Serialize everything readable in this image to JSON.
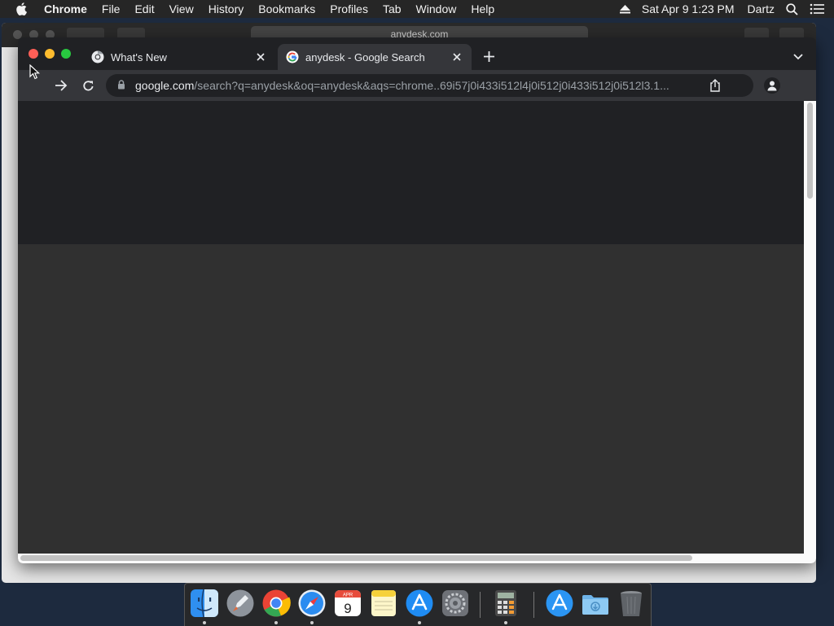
{
  "menubar": {
    "app_name": "Chrome",
    "items": [
      "File",
      "Edit",
      "View",
      "History",
      "Bookmarks",
      "Profiles",
      "Tab",
      "Window",
      "Help"
    ],
    "clock": "Sat Apr 9  1:23 PM",
    "user": "Dartz",
    "icons": [
      "apple-icon",
      "eject-icon",
      "spotlight-icon",
      "control-center-icon"
    ]
  },
  "background_window": {
    "url": "anydesk.com"
  },
  "chrome": {
    "tabs": [
      {
        "title": "What's New",
        "favicon": "chrome-icon",
        "active": false
      },
      {
        "title": "anydesk - Google Search",
        "favicon": "google-icon",
        "active": true
      }
    ],
    "omnibox": {
      "domain": "google.com",
      "path": "/search?q=anydesk&oq=anydesk&aqs=chrome..69i57j0i433i512l4j0i512j0i433i512j0i512l3.1..."
    }
  },
  "dock": {
    "apps": [
      {
        "name": "Finder",
        "running": true
      },
      {
        "name": "Launchpad",
        "running": false
      },
      {
        "name": "Google Chrome",
        "running": true
      },
      {
        "name": "Safari",
        "running": true
      },
      {
        "name": "Calendar",
        "running": false,
        "month": "APR",
        "day": "9"
      },
      {
        "name": "Notes",
        "running": false
      },
      {
        "name": "App Store",
        "running": true
      },
      {
        "name": "System Preferences",
        "running": false
      },
      {
        "name": "Calculator",
        "running": true
      },
      {
        "name": "Applications",
        "running": false
      },
      {
        "name": "Downloads",
        "running": false
      },
      {
        "name": "Trash",
        "running": false
      }
    ]
  },
  "colors": {
    "tabstrip_bg": "#202124",
    "toolbar_bg": "#35363a",
    "content_bg": "#303030",
    "close_red": "#ff5f57",
    "minimize_yellow": "#febc2e",
    "zoom_green": "#28c840"
  }
}
